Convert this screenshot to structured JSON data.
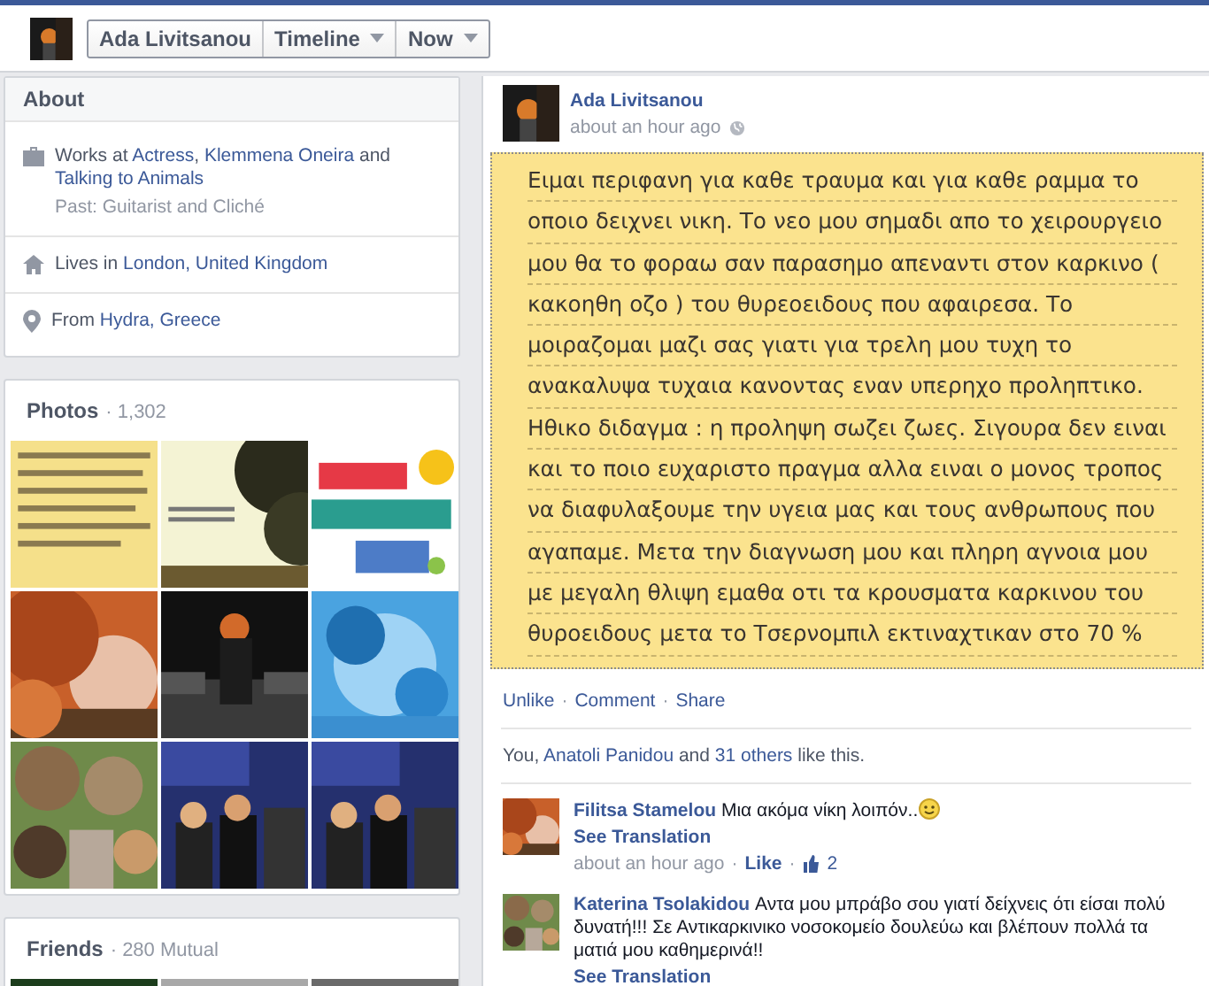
{
  "header": {
    "buttons": [
      {
        "label": "Ada Livitsanou",
        "dropdown": false
      },
      {
        "label": "Timeline",
        "dropdown": true
      },
      {
        "label": "Now",
        "dropdown": true
      }
    ]
  },
  "about": {
    "title": "About",
    "items": [
      {
        "kind": "work",
        "parts": [
          {
            "text": "Works at "
          },
          {
            "text": "Actress",
            "link": true
          },
          {
            "text": ", "
          },
          {
            "text": "Klemmena Oneira",
            "link": true
          },
          {
            "text": " and "
          },
          {
            "text": "Talking to Animals",
            "link": true
          }
        ],
        "sub": "Past: Guitarist and Cliché"
      },
      {
        "kind": "home",
        "parts": [
          {
            "text": "Lives in "
          },
          {
            "text": "London, United Kingdom",
            "link": true
          }
        ]
      },
      {
        "kind": "place",
        "parts": [
          {
            "text": "From "
          },
          {
            "text": "Hydra, Greece",
            "link": true
          }
        ]
      }
    ]
  },
  "photos": {
    "title": "Photos",
    "count": "· 1,302"
  },
  "friends": {
    "title": "Friends",
    "count": "· 280 Mutual"
  },
  "post": {
    "author": "Ada Livitsanou",
    "time": "about an hour ago",
    "note_lines": [
      "Ειμαι περιφανη για καθε τραυμα και για καθε ραμμα το",
      "οποιο δειχνει νικη. Το νεο μου σημαδι απο το χειρουργειο",
      "μου θα το φοραω σαν παρασημο απεναντι στον  καρκινο (",
      "κακοηθη οζο ) του θυρεοειδους που αφαιρεσα.  Το",
      "μοιραζομαι μαζι σας  γιατι για τρελη μου τυχη το",
      "ανακαλυψα τυχαια κανοντας εναν υπερηχο προληπτικο.",
      "Ηθικο διδαγμα : η προληψη σωζει ζωες. Σιγουρα δεν ειναι",
      "και το ποιο ευχαριστο πραγμα αλλα ειναι ο μονος τροπος",
      "να διαφυλαξουμε την υγεια μας και τους ανθρωπους που",
      "αγαπαμε.  Μετα την διαγνωση μου και πληρη αγνοια μου",
      "με μεγαλη θλιψη εμαθα οτι τα κρουσματα καρκινου του",
      "θυροειδους μετα το Τσερνομπιλ εκτιναχτικαν στο 70 %"
    ],
    "actions": [
      {
        "kind": "link",
        "text": "Unlike"
      },
      {
        "kind": "dot",
        "text": "·"
      },
      {
        "kind": "link",
        "text": "Comment"
      },
      {
        "kind": "dot",
        "text": "·"
      },
      {
        "kind": "link",
        "text": "Share"
      }
    ],
    "likes": [
      {
        "text": "You, "
      },
      {
        "text": "Anatoli Panidou",
        "link": true
      },
      {
        "text": " and "
      },
      {
        "text": "31 others",
        "link": true
      },
      {
        "text": " like this."
      }
    ],
    "comments": [
      {
        "author": "Filitsa Stamelou",
        "text": "Μια ακόμα νίκη λοιπόν..",
        "smiley": true,
        "translation": "See Translation",
        "meta": [
          {
            "kind": "time",
            "text": "about an hour ago"
          },
          {
            "kind": "dot",
            "text": "·"
          },
          {
            "kind": "link",
            "text": "Like"
          },
          {
            "kind": "dot",
            "text": "·"
          },
          {
            "kind": "likes",
            "text": "2"
          }
        ]
      },
      {
        "author": "Katerina Tsolakidou",
        "text": "Αντα μου μπράβο σου γιατί δείχνεις ότι είσαι πολύ δυνατή!!! Σε Αντικαρκινικο νοσοκομείο δουλεύω και βλέπουν πολλά τα ματιά μου καθημερινά!!",
        "smiley": false,
        "translation": "See Translation"
      }
    ]
  }
}
